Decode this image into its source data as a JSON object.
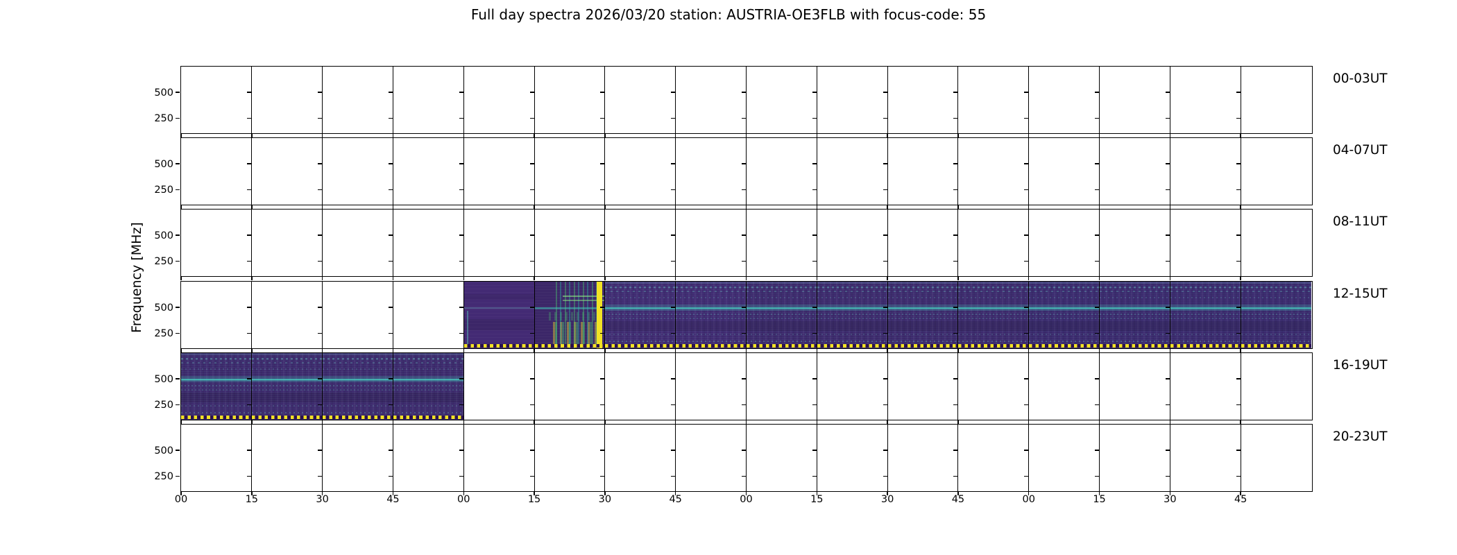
{
  "title": "Full day spectra 2026/03/20 station: AUSTRIA-OE3FLB with focus-code: 55",
  "ylabel": "Frequency [MHz]",
  "chart_data": {
    "type": "heatmap",
    "subtype": "solar radio spectrogram day overview (6 stacked 4-hour strips of 15-min panels)",
    "title": "Full day spectra 2026/03/20 station: AUSTRIA-OE3FLB with focus-code: 55",
    "station": "AUSTRIA-OE3FLB",
    "date": "2026/03/20",
    "focus_code": "55",
    "ylabel": "Frequency [MHz]",
    "y_tick_labels": [
      "500",
      "250"
    ],
    "x_tick_labels": [
      "00",
      "15",
      "30",
      "45",
      "00",
      "15",
      "30",
      "45",
      "00",
      "15",
      "30",
      "45",
      "00",
      "15",
      "30",
      "45"
    ],
    "minutes_per_column": 15,
    "columns_per_row": 16,
    "colormap": "viridis",
    "grid": "black panel borders every 15 minutes, no interior gridlines",
    "legend": "none",
    "rows": [
      {
        "label": "00-03UT",
        "time_span": "00:00-04:00 UT",
        "has_data": false,
        "data_interval": "",
        "cells": [
          "empty",
          "empty",
          "empty",
          "empty",
          "empty",
          "empty",
          "empty",
          "empty",
          "empty",
          "empty",
          "empty",
          "empty",
          "empty",
          "empty",
          "empty",
          "empty"
        ]
      },
      {
        "label": "04-07UT",
        "time_span": "04:00-08:00 UT",
        "has_data": false,
        "data_interval": "",
        "cells": [
          "empty",
          "empty",
          "empty",
          "empty",
          "empty",
          "empty",
          "empty",
          "empty",
          "empty",
          "empty",
          "empty",
          "empty",
          "empty",
          "empty",
          "empty",
          "empty"
        ]
      },
      {
        "label": "08-11UT",
        "time_span": "08:00-12:00 UT",
        "has_data": false,
        "data_interval": "",
        "cells": [
          "empty",
          "empty",
          "empty",
          "empty",
          "empty",
          "empty",
          "empty",
          "empty",
          "empty",
          "empty",
          "empty",
          "empty",
          "empty",
          "empty",
          "empty",
          "empty"
        ]
      },
      {
        "label": "12-15UT",
        "time_span": "12:00-16:00 UT",
        "has_data": true,
        "data_interval": "13:00-16:00 UT",
        "cells": [
          "empty",
          "empty",
          "empty",
          "empty",
          "calm",
          "burst",
          "texa",
          "texa",
          "texb",
          "texb",
          "texb",
          "texb",
          "texc",
          "texc",
          "texc",
          "texc"
        ]
      },
      {
        "label": "16-19UT",
        "time_span": "16:00-20:00 UT",
        "has_data": true,
        "data_interval": "16:00-17:00 UT",
        "cells": [
          "texb",
          "texb",
          "texb",
          "texb",
          "empty",
          "empty",
          "empty",
          "empty",
          "empty",
          "empty",
          "empty",
          "empty",
          "empty",
          "empty",
          "empty",
          "empty"
        ]
      },
      {
        "label": "20-23UT",
        "time_span": "20:00-24:00 UT",
        "has_data": false,
        "data_interval": "",
        "cells": [
          "empty",
          "empty",
          "empty",
          "empty",
          "empty",
          "empty",
          "empty",
          "empty",
          "empty",
          "empty",
          "empty",
          "empty",
          "empty",
          "empty",
          "empty",
          "empty"
        ]
      }
    ],
    "annotations": {
      "burst": "Saturated bright-yellow broadband burst around 13:25-13:30 UT",
      "persistent_line": "Persistent narrow teal interference line near 500 MHz across all recorded segments",
      "bottom_marker": "Yellow dashed marker strip along the bottom edge of every recorded segment"
    },
    "colors": {
      "figure_background": "#ffffff",
      "axis": "#000000",
      "spec_background": "#40296f",
      "spec_teal_line": "#46cdbe",
      "spec_green_streak": "#4ac16d",
      "spec_burst_yellow": "#f2e224"
    }
  }
}
